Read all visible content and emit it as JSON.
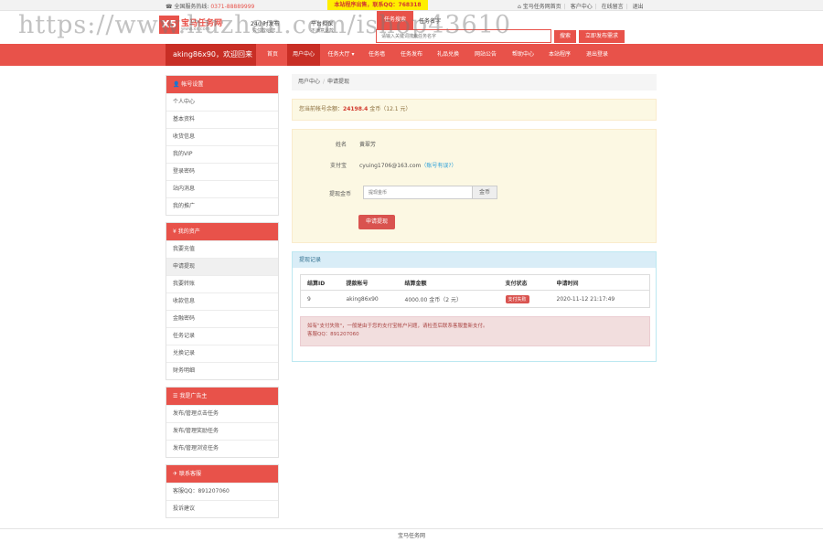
{
  "topbar": {
    "hotline_label": "全国服务热线:",
    "hotline_number": "0371-88889999",
    "notice": "本站程序出售，联系QQ：768318",
    "links": [
      "宝马任务网首页",
      "客户中心",
      "在线留言",
      "退出"
    ]
  },
  "header": {
    "logo_mark": "X5",
    "logo_text": "宝马任务网",
    "logo_url": "www.xx.com",
    "slogan_1": "24小时发布",
    "slogan_2": "只付款给您",
    "slogan_3": "平台担保",
    "slogan_4": "不满意退款",
    "search_tab_active": "任务搜索",
    "search_tab_other": "任务名字",
    "search_placeholder": "请输入关键词搜索任务名字",
    "search_button": "搜索",
    "publish_button": "立即发布需求"
  },
  "nav": {
    "user_greeting": "aking86x90，欢迎回来",
    "items": [
      "首页",
      "用户中心",
      "任务大厅 ▾",
      "任务墙",
      "任务发布",
      "礼品兑换",
      "网站公告",
      "帮助中心",
      "本站程序",
      "退出登录"
    ]
  },
  "sidebar": {
    "account": {
      "title": "帐号设置",
      "items": [
        "个人中心",
        "基本资料",
        "收货信息",
        "我的VIP",
        "登录密码",
        "站内消息",
        "我的推广"
      ]
    },
    "assets": {
      "title": "我的资产",
      "items": [
        "我要充值",
        "申请提现",
        "我要转账",
        "收款信息",
        "金融密码",
        "任务记录",
        "兑换记录",
        "财务明细"
      ]
    },
    "advertiser": {
      "title": "我是广告主",
      "items": [
        "发布/管理点击任务",
        "发布/管理奖励任务",
        "发布/管理浏览任务"
      ]
    },
    "contact": {
      "title": "联系客服",
      "items": [
        "客服QQ：891207060",
        "投诉建议"
      ]
    }
  },
  "breadcrumb": {
    "root": "用户中心",
    "current": "申请提现"
  },
  "balance": {
    "prefix": "您当前帐号余额：",
    "amount": "24198.4",
    "suffix": "金币（12.1 元）"
  },
  "form": {
    "name_label": "姓名",
    "name_value": "黄翠芳",
    "alipay_label": "支付宝",
    "alipay_value": "cyuing1706@163.com",
    "alipay_link": "（账号有误?）",
    "amount_label": "提现金币",
    "amount_placeholder": "提现金币",
    "amount_unit": "金币",
    "submit_button": "申请提现"
  },
  "records": {
    "title": "提现记录",
    "columns": [
      "结算ID",
      "提款帐号",
      "结算金额",
      "支付状态",
      "申请时间"
    ],
    "rows": [
      {
        "id": "9",
        "account": "aking86x90",
        "amount": "4000.00 金币（2 元）",
        "status": "支付失败",
        "time": "2020-11-12 21:17:49"
      }
    ],
    "alert_line1": "如有\"支付失败\"，一般是由于您的支付宝帐户问题，请检查后联系客服重新支付。",
    "alert_line2": "客服QQ：891207060"
  },
  "footer": {
    "text": "宝马任务网"
  },
  "watermark": "https://www.huzhan.com/ishop43610",
  "colors": {
    "brand_red": "#e8524a",
    "dark_red": "#c82e25",
    "info_blue": "#d9edf7",
    "warn_yellow": "#fcf8e3"
  }
}
